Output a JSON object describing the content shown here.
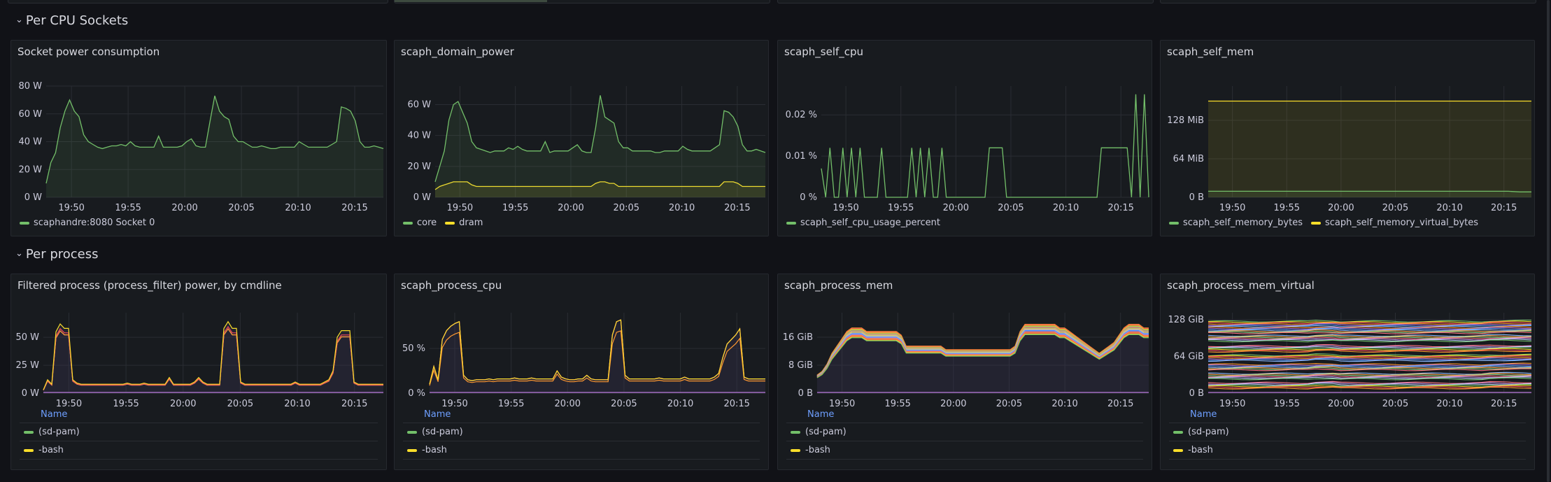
{
  "colors": {
    "green": "#73bf69",
    "yellow": "#fade2a",
    "orange": "#ff9830",
    "pink": "#f2495c",
    "purple": "#b877d9",
    "blue": "#5794f2",
    "bg": "#181b1f",
    "grid": "#2a2d33"
  },
  "rows": [
    {
      "title": "Per CPU Sockets",
      "chevron": "chevron-down-icon"
    },
    {
      "title": "Per process",
      "chevron": "chevron-down-icon"
    }
  ],
  "x_ticks": [
    "19:50",
    "19:55",
    "20:00",
    "20:05",
    "20:10",
    "20:15"
  ],
  "panels": [
    {
      "title": "Socket power consumption",
      "y_ticks": [
        "0 W",
        "20 W",
        "40 W",
        "60 W",
        "80 W"
      ],
      "legend": [
        {
          "label": "scaphandre:8080 Socket 0",
          "color": "#73bf69"
        }
      ],
      "chart_data": {
        "type": "area",
        "ylim": [
          0,
          80
        ],
        "unit": "W",
        "series": [
          {
            "name": "scaphandre:8080 Socket 0",
            "color": "#73bf69",
            "values": [
              10,
              25,
              32,
              50,
              62,
              70,
              62,
              58,
              45,
              40,
              38,
              36,
              35,
              36,
              37,
              37,
              38,
              37,
              40,
              37,
              36,
              36,
              36,
              36,
              44,
              36,
              36,
              36,
              36,
              37,
              40,
              42,
              37,
              36,
              36,
              55,
              73,
              62,
              58,
              56,
              44,
              40,
              40,
              38,
              36,
              36,
              37,
              36,
              35,
              35,
              36,
              36,
              36,
              36,
              40,
              38,
              36,
              36,
              36,
              36,
              36,
              38,
              40,
              65,
              64,
              62,
              55,
              40,
              36,
              36,
              37,
              36,
              35
            ]
          }
        ]
      }
    },
    {
      "title": "scaph_domain_power",
      "y_ticks": [
        "0 W",
        "20 W",
        "40 W",
        "60 W"
      ],
      "legend": [
        {
          "label": "core",
          "color": "#73bf69"
        },
        {
          "label": "dram",
          "color": "#fade2a"
        }
      ],
      "chart_data": {
        "type": "area",
        "ylim": [
          0,
          72
        ],
        "unit": "W",
        "series": [
          {
            "name": "core",
            "color": "#73bf69",
            "values": [
              10,
              20,
              30,
              50,
              60,
              62,
              55,
              48,
              36,
              32,
              31,
              30,
              29,
              30,
              30,
              30,
              32,
              31,
              33,
              31,
              30,
              30,
              30,
              30,
              36,
              29,
              30,
              30,
              30,
              30,
              32,
              34,
              30,
              29,
              29,
              45,
              66,
              52,
              50,
              48,
              36,
              32,
              32,
              30,
              30,
              30,
              30,
              30,
              29,
              29,
              30,
              30,
              30,
              30,
              33,
              31,
              30,
              30,
              30,
              30,
              30,
              32,
              34,
              56,
              55,
              52,
              46,
              34,
              30,
              30,
              31,
              30,
              29
            ]
          },
          {
            "name": "dram",
            "color": "#fade2a",
            "values": [
              5,
              7,
              8,
              9,
              10,
              10,
              10,
              10,
              8,
              7,
              7,
              7,
              7,
              7,
              7,
              7,
              7,
              7,
              7,
              7,
              7,
              7,
              7,
              7,
              7,
              7,
              7,
              7,
              7,
              7,
              7,
              7,
              7,
              7,
              7,
              9,
              10,
              10,
              9,
              9,
              7,
              7,
              7,
              7,
              7,
              7,
              7,
              7,
              7,
              7,
              7,
              7,
              7,
              7,
              7,
              7,
              7,
              7,
              7,
              7,
              7,
              7,
              7,
              10,
              10,
              10,
              9,
              7,
              7,
              7,
              7,
              7,
              7
            ]
          }
        ]
      }
    },
    {
      "title": "scaph_self_cpu",
      "y_ticks": [
        "0 %",
        "0.01 %",
        "0.02 %"
      ],
      "legend": [
        {
          "label": "scaph_self_cpu_usage_percent",
          "color": "#73bf69"
        }
      ],
      "chart_data": {
        "type": "line",
        "ylim": [
          0,
          0.027
        ],
        "unit": "%",
        "series": [
          {
            "name": "scaph_self_cpu_usage_percent",
            "color": "#73bf69",
            "values": [
              0.007,
              0,
              0.012,
              0,
              0,
              0.012,
              0,
              0.012,
              0,
              0.012,
              0,
              0,
              0,
              0,
              0.012,
              0,
              0,
              0,
              0,
              0,
              0,
              0.012,
              0,
              0.012,
              0,
              0.012,
              0,
              0,
              0.012,
              0,
              0,
              0,
              0,
              0,
              0,
              0,
              0,
              0,
              0,
              0.012,
              0.012,
              0.012,
              0.012,
              0,
              0,
              0,
              0,
              0,
              0,
              0,
              0,
              0,
              0,
              0,
              0,
              0,
              0,
              0,
              0,
              0,
              0,
              0,
              0,
              0,
              0,
              0.012,
              0.012,
              0.012,
              0.012,
              0.012,
              0.012,
              0.012,
              0,
              0.025,
              0,
              0.025,
              0
            ]
          }
        ]
      }
    },
    {
      "title": "scaph_self_mem",
      "y_ticks": [
        "0 B",
        "64 MiB",
        "128 MiB"
      ],
      "legend": [
        {
          "label": "scaph_self_memory_bytes",
          "color": "#73bf69"
        },
        {
          "label": "scaph_self_memory_virtual_bytes",
          "color": "#fade2a"
        }
      ],
      "chart_data": {
        "type": "area",
        "ylim": [
          0,
          185
        ],
        "unit": "MiB",
        "series": [
          {
            "name": "scaph_self_memory_bytes",
            "color": "#73bf69",
            "values": [
              10,
              10,
              10,
              10,
              10,
              10,
              10,
              10,
              10,
              10,
              10,
              10,
              10,
              10,
              10,
              10,
              10,
              10,
              10,
              10,
              10,
              10,
              10,
              10,
              10,
              10,
              10,
              9,
              9
            ]
          },
          {
            "name": "scaph_self_memory_virtual_bytes",
            "color": "#fade2a",
            "values": [
              160,
              160,
              160,
              160,
              160,
              160,
              160,
              160,
              160,
              160,
              160,
              160,
              160,
              160,
              160,
              160,
              160,
              160,
              160,
              160,
              160,
              160,
              160,
              160,
              160,
              160,
              160,
              160,
              160
            ]
          }
        ]
      }
    },
    {
      "title": "Filtered process (process_filter) power, by cmdline",
      "y_ticks": [
        "0 W",
        "25 W",
        "50 W"
      ],
      "legend_header": "Name",
      "legend": [
        {
          "label": "(sd-pam)",
          "color": "#73bf69"
        },
        {
          "label": "-bash",
          "color": "#fade2a"
        }
      ],
      "chart_data": {
        "type": "line",
        "ylim": [
          0,
          72
        ],
        "unit": "W",
        "series_shape": [
          3,
          12,
          8,
          55,
          62,
          58,
          58,
          12,
          9,
          8,
          8,
          8,
          8,
          8,
          8,
          8,
          8,
          8,
          8,
          8,
          9,
          8,
          8,
          8,
          9,
          8,
          8,
          8,
          8,
          8,
          14,
          8,
          8,
          8,
          8,
          8,
          10,
          14,
          10,
          8,
          8,
          8,
          8,
          58,
          64,
          58,
          58,
          10,
          8,
          8,
          8,
          8,
          8,
          8,
          8,
          8,
          8,
          8,
          8,
          8,
          10,
          8,
          8,
          8,
          8,
          8,
          8,
          10,
          12,
          20,
          50,
          56,
          56,
          56,
          10,
          8,
          8,
          8,
          8,
          8,
          8,
          8
        ]
      }
    },
    {
      "title": "scaph_process_cpu",
      "y_ticks": [
        "0 %",
        "50 %"
      ],
      "legend_header": "Name",
      "legend": [
        {
          "label": "(sd-pam)",
          "color": "#73bf69"
        },
        {
          "label": "-bash",
          "color": "#fade2a"
        }
      ],
      "chart_data": {
        "type": "line",
        "ylim": [
          0,
          90
        ],
        "unit": "%",
        "series_shape": [
          10,
          30,
          15,
          60,
          70,
          75,
          78,
          80,
          20,
          15,
          14,
          15,
          15,
          15,
          16,
          15,
          16,
          16,
          16,
          16,
          17,
          16,
          16,
          16,
          17,
          16,
          16,
          16,
          16,
          16,
          25,
          18,
          16,
          15,
          15,
          16,
          16,
          20,
          16,
          15,
          15,
          15,
          15,
          65,
          80,
          82,
          20,
          16,
          16,
          16,
          16,
          16,
          16,
          16,
          17,
          16,
          16,
          16,
          16,
          16,
          18,
          16,
          16,
          16,
          16,
          16,
          16,
          18,
          22,
          40,
          55,
          60,
          65,
          72,
          18,
          16,
          16,
          16,
          16,
          16
        ]
      }
    },
    {
      "title": "scaph_process_mem",
      "y_ticks": [
        "0 B",
        "8 GiB",
        "16 GiB"
      ],
      "legend_header": "Name",
      "legend": [
        {
          "label": "(sd-pam)",
          "color": "#73bf69"
        },
        {
          "label": "-bash",
          "color": "#fade2a"
        }
      ],
      "chart_data": {
        "type": "line",
        "ylim": [
          0,
          23
        ],
        "unit": "GiB",
        "series_shape": [
          5,
          6,
          8,
          11,
          13,
          15,
          17,
          18,
          18,
          18,
          17,
          17,
          17,
          17,
          17,
          17,
          17,
          16,
          13,
          13,
          13,
          13,
          13,
          13,
          13,
          13,
          12,
          12,
          12,
          12,
          12,
          12,
          12,
          12,
          12,
          12,
          12,
          12,
          12,
          12,
          13,
          17,
          19,
          19,
          19,
          19,
          19,
          19,
          19,
          18,
          18,
          17,
          16,
          15,
          14,
          13,
          12,
          11,
          12,
          13,
          14,
          16,
          18,
          19,
          19,
          19,
          18,
          18
        ]
      }
    },
    {
      "title": "scaph_process_mem_virtual",
      "y_ticks": [
        "0 B",
        "64 GiB",
        "128 GiB"
      ],
      "legend_header": "Name",
      "legend": [
        {
          "label": "(sd-pam)",
          "color": "#73bf69"
        },
        {
          "label": "-bash",
          "color": "#fade2a"
        }
      ],
      "chart_data": {
        "type": "line",
        "ylim": [
          0,
          140
        ],
        "unit": "GiB",
        "band_levels": [
          125,
          114,
          100,
          82,
          66,
          50,
          34,
          18
        ]
      }
    }
  ]
}
